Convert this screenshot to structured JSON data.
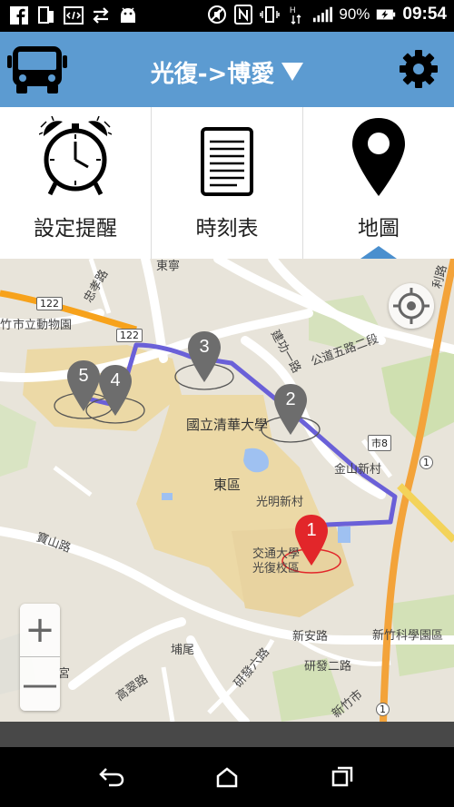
{
  "status": {
    "battery": "90%",
    "time": "09:54",
    "icons": [
      "facebook-icon",
      "tablet-icon",
      "code-icon",
      "transfer-icon",
      "android-icon",
      "mute-icon",
      "nfc-icon",
      "vibrate-icon",
      "data-icon",
      "signal-icon",
      "battery-charging-icon"
    ]
  },
  "appbar": {
    "title": "光復->博愛",
    "icons": [
      "bus-icon",
      "dropdown-caret-icon",
      "gear-icon"
    ]
  },
  "tabs": [
    {
      "label": "設定提醒",
      "icon": "alarm-clock-icon",
      "selected": false
    },
    {
      "label": "時刻表",
      "icon": "timetable-icon",
      "selected": false
    },
    {
      "label": "地圖",
      "icon": "map-pin-icon",
      "selected": true
    }
  ],
  "map": {
    "labels": {
      "zoo": "市立動物園",
      "zoo_prefix": "竹",
      "road1": "公道五路二段",
      "road2": "建功一路",
      "nthu": "國立清華大學",
      "district": "東區",
      "village1": "光明新村",
      "village2": "金山新村",
      "nctu": "交通大學",
      "nctu2": "光復校區",
      "baoshan": "寶山路",
      "xinan": "新安路",
      "science": "新竹科學園區",
      "yanfa": "研發二路",
      "gaocui": "高翠路",
      "ground": "埔尾",
      "east_top": "東寧",
      "gong": "宮",
      "research": "研發六路",
      "loyalty": "忠孝路",
      "city8": "市8",
      "route122a": "122",
      "route122b": "122",
      "route1a": "1",
      "route1b": "1",
      "lee": "利路",
      "xinzhu": "新竹市"
    },
    "markers": [
      {
        "num": "5",
        "color": "#6d6d6d"
      },
      {
        "num": "4",
        "color": "#6d6d6d"
      },
      {
        "num": "3",
        "color": "#6d6d6d"
      },
      {
        "num": "2",
        "color": "#6d6d6d"
      },
      {
        "num": "1",
        "color": "#e2262a"
      }
    ],
    "route_color": "#6a60d8",
    "zoom_in": "+",
    "zoom_out": "—"
  },
  "nav": {
    "icons": [
      "back-icon",
      "home-icon",
      "recents-icon"
    ]
  }
}
